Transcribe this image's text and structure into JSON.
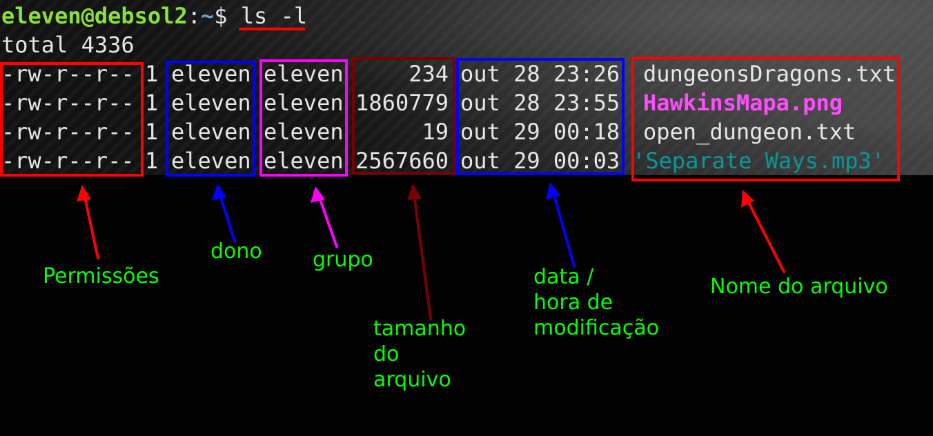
{
  "terminal": {
    "prompt_user_host": "eleven@debsol2",
    "prompt_colon": ":",
    "prompt_path": "~",
    "prompt_symbol": "$ ",
    "command": "ls -l",
    "total_line": "total 4336",
    "rows": [
      {
        "perms": "-rw-r--r--",
        "links": "1",
        "owner": "eleven",
        "group": "eleven",
        "size": "234",
        "date": "out 28 23:26",
        "name": "dungeonsDragons.txt"
      },
      {
        "perms": "-rw-r--r--",
        "links": "1",
        "owner": "eleven",
        "group": "eleven",
        "size": "1860779",
        "date": "out 28 23:55",
        "name": "HawkinsMapa.png"
      },
      {
        "perms": "-rw-r--r--",
        "links": "1",
        "owner": "eleven",
        "group": "eleven",
        "size": "19",
        "date": "out 29 00:18",
        "name": "open_dungeon.txt"
      },
      {
        "perms": "-rw-r--r--",
        "links": "1",
        "owner": "eleven",
        "group": "eleven",
        "size": "2567660",
        "date": "out 29 00:03",
        "name": "'Separate Ways.mp3'"
      }
    ]
  },
  "annotations": {
    "permissions": "Permissões",
    "owner": "dono",
    "group": "grupo",
    "size": "tamanho\ndo\narquivo",
    "date": "data /\nhora de\nmodificação",
    "name": "Nome do arquivo"
  },
  "colors": {
    "prompt_user": "#8ae234",
    "prompt_path": "#729fcf",
    "image_file": "#ff4dff",
    "audio_file": "#06989a",
    "label": "#00ff00",
    "permissions_box": "#ff0000",
    "owner_box": "#0000ff",
    "group_box": "#ff00ff",
    "size_box": "#7a0000",
    "date_box": "#0000ff",
    "name_box": "#ff0000"
  }
}
